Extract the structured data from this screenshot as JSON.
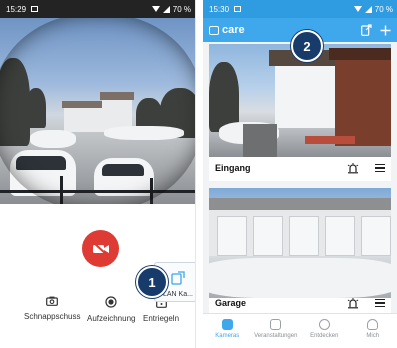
{
  "left_screen": {
    "status_bar": {
      "time": "15:29",
      "battery": "70 %"
    },
    "controls": [
      {
        "label": "Schnappschuss",
        "icon": "camera-icon"
      },
      {
        "label": "Aufzeichnung",
        "icon": "record-icon"
      },
      {
        "label": "Entriegeln",
        "icon": "unlock-icon"
      }
    ],
    "lan_card_label": "LAN Ka...",
    "step_badge": "1"
  },
  "right_screen": {
    "status_bar": {
      "time": "15:30",
      "battery": "70 %"
    },
    "app_logo": "care",
    "step_badge": "2",
    "cameras": [
      {
        "name": "Eingang"
      },
      {
        "name": "Garage"
      }
    ],
    "bottom_nav": [
      {
        "label": "Kameras",
        "active": true
      },
      {
        "label": "Veranstaltungen",
        "active": false
      },
      {
        "label": "Entdecken",
        "active": false
      },
      {
        "label": "Mich",
        "active": false
      }
    ]
  },
  "colors": {
    "record_button": "#dd3b33",
    "app_blue": "#3fa7ec",
    "badge_navy": "#173c6b"
  }
}
